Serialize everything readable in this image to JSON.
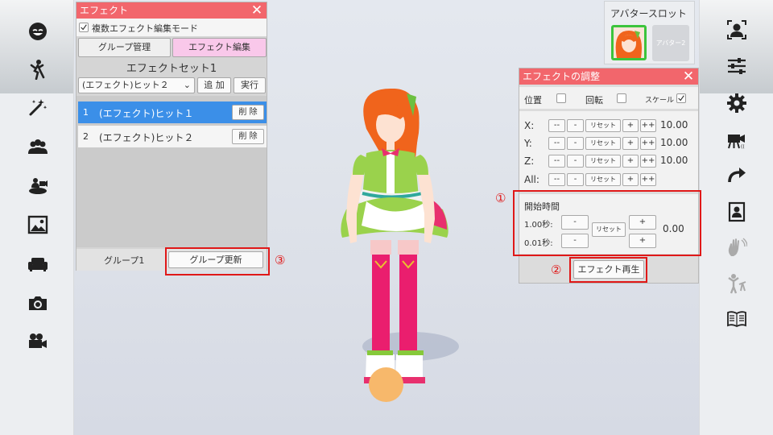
{
  "left_sidebar": {
    "icons": [
      "face-icon",
      "pose-icon",
      "magic-wand-icon",
      "group-icon",
      "stage-camera-icon",
      "image-icon",
      "sofa-icon",
      "camera-icon",
      "video-camera-icon"
    ]
  },
  "right_sidebar": {
    "icons": [
      "portrait-icon",
      "sliders-icon",
      "gear-icon",
      "video-camera-icon",
      "redo-arrow-icon",
      "id-card-icon",
      "hand-wave-icon",
      "figure-telescope-icon",
      "book-icon"
    ]
  },
  "effect_panel": {
    "title": "エフェクト",
    "multi_edit_label": "複数エフェクト編集モード",
    "tabs": [
      "グループ管理",
      "エフェクト編集"
    ],
    "set_title": "エフェクトセット1",
    "dropdown_value": "(エフェクト)ヒット２",
    "add_button": "追 加",
    "run_button": "実行",
    "items": [
      {
        "index": "1",
        "name": "(エフェクト)ヒット１",
        "delete": "削 除"
      },
      {
        "index": "2",
        "name": "(エフェクト)ヒット２",
        "delete": "削 除"
      }
    ],
    "group_label": "グループ1",
    "group_update_button": "グループ更新"
  },
  "avatar_slot": {
    "title": "アバタースロット",
    "slot2_label": "アバター2"
  },
  "adjust_panel": {
    "title": "エフェクトの調整",
    "position_label": "位置",
    "rotation_label": "回転",
    "scale_label": "スケール",
    "axes": [
      {
        "label": "X:",
        "value": "10.00"
      },
      {
        "label": "Y:",
        "value": "10.00"
      },
      {
        "label": "Z:",
        "value": "10.00"
      },
      {
        "label": "All:",
        "value": ""
      }
    ],
    "btn_mm": "--",
    "btn_m": "-",
    "btn_reset": "リセット",
    "btn_p": "+",
    "btn_pp": "++",
    "start_time_label": "開始時間",
    "step1_label": "1.00秒:",
    "step2_label": "0.01秒:",
    "start_value": "0.00",
    "play_button": "エフェクト再生"
  },
  "annotations": [
    "①",
    "②",
    "③"
  ]
}
